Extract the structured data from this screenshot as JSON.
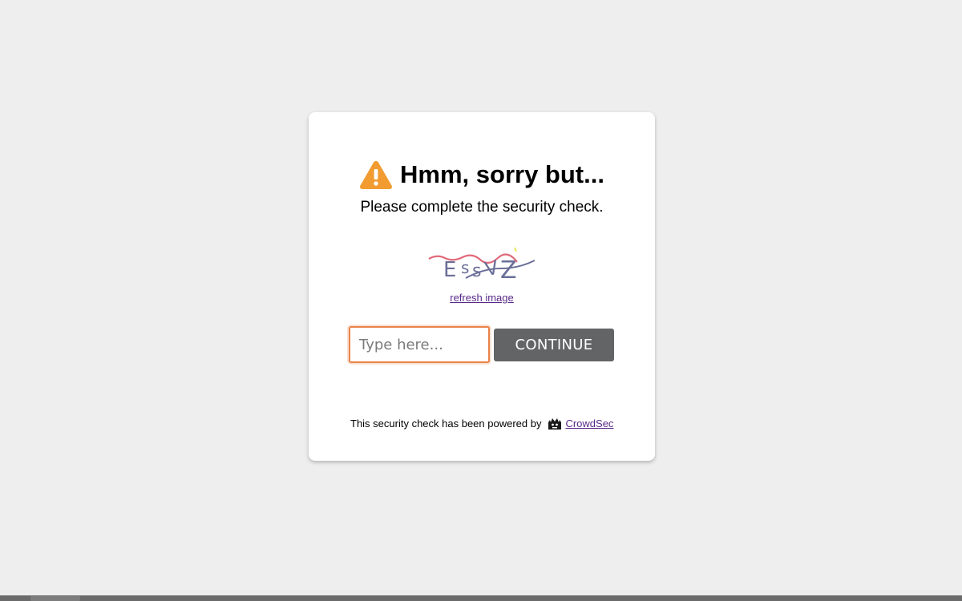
{
  "header": {
    "headline": "Hmm, sorry but...",
    "subtitle": "Please complete the security check."
  },
  "icons": {
    "warning": "warning-icon",
    "crowdsec": "crowdsec-logo-icon"
  },
  "captcha": {
    "image_text": "ESSVZ",
    "refresh_label": "refresh image",
    "input_placeholder": "Type here...",
    "input_value": "",
    "continue_label": "CONTINUE"
  },
  "footer": {
    "powered_text": "This security check has been powered by",
    "link_label": "CrowdSec"
  },
  "colors": {
    "background": "#eeeeee",
    "card": "#ffffff",
    "warning": "#f29b30",
    "input_border": "#e8834a",
    "button": "#636465",
    "link": "#5a2a8a"
  }
}
